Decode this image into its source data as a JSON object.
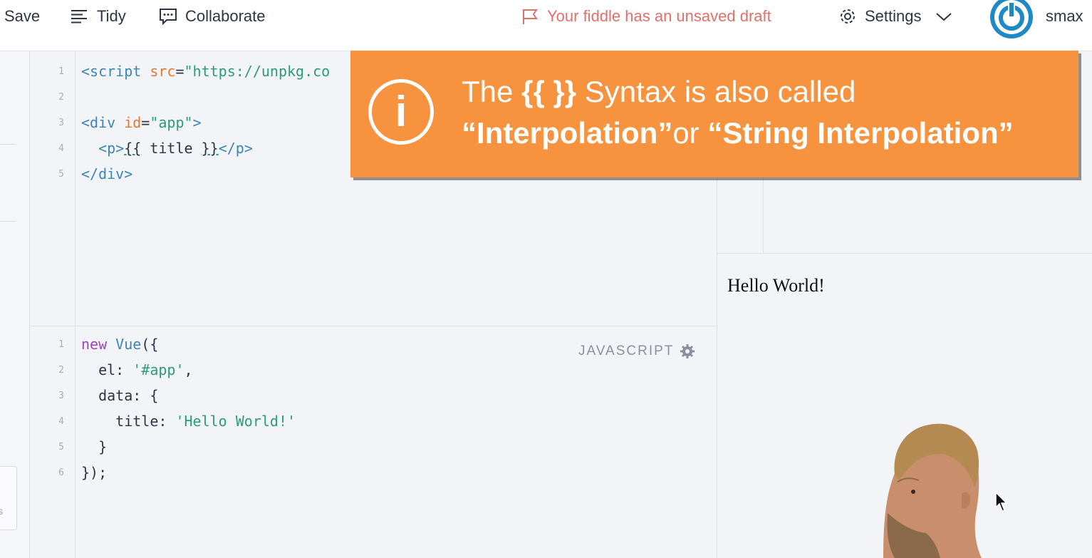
{
  "toolbar": {
    "save_label": "Save",
    "tidy_label": "Tidy",
    "collaborate_label": "Collaborate",
    "draft_notice": "Your fiddle has an unsaved draft",
    "settings_label": "Settings",
    "username": "smax"
  },
  "sidebar": {
    "partial_label": "s"
  },
  "html_panel": {
    "line_numbers": [
      "1",
      "2",
      "3",
      "4",
      "5"
    ],
    "lines": {
      "l1_tag_open": "<script",
      "l1_attr": " src",
      "l1_eq": "=",
      "l1_value": "\"https://unpkg.co",
      "l3_tag_open": "<div",
      "l3_attr": " id",
      "l3_eq": "=",
      "l3_value": "\"app\"",
      "l3_tag_close": ">",
      "l4_indent": "  ",
      "l4_p_open": "<p>",
      "l4_open_brace": "{{",
      "l4_expr": " title ",
      "l4_close_brace": "}}",
      "l4_p_close": "</p>",
      "l5_div_close": "</div>"
    }
  },
  "js_panel": {
    "label": "JAVASCRIPT",
    "line_numbers": [
      "1",
      "2",
      "3",
      "4",
      "5",
      "6"
    ],
    "lines": {
      "l1_kw": "new",
      "l1_fn": " Vue",
      "l1_rest": "({",
      "l2_key": "  el: ",
      "l2_val": "'#app'",
      "l2_rest": ",",
      "l3": "  data: {",
      "l4_key": "    title: ",
      "l4_val": "'Hello World!'",
      "l5": "  }",
      "l6": "});"
    }
  },
  "output": {
    "text": "Hello World!"
  },
  "callout": {
    "line1_prefix": "The ",
    "line1_braces": "{{ }}",
    "line1_suffix": " Syntax is also called",
    "line2_term1": "“Interpolation”",
    "line2_or": "or ",
    "line2_term2": "“String Interpolation”",
    "info_glyph": "i"
  },
  "colors": {
    "callout_bg": "#f7923f",
    "draft_text": "#e0706a",
    "avatar": "#1f88c7"
  }
}
